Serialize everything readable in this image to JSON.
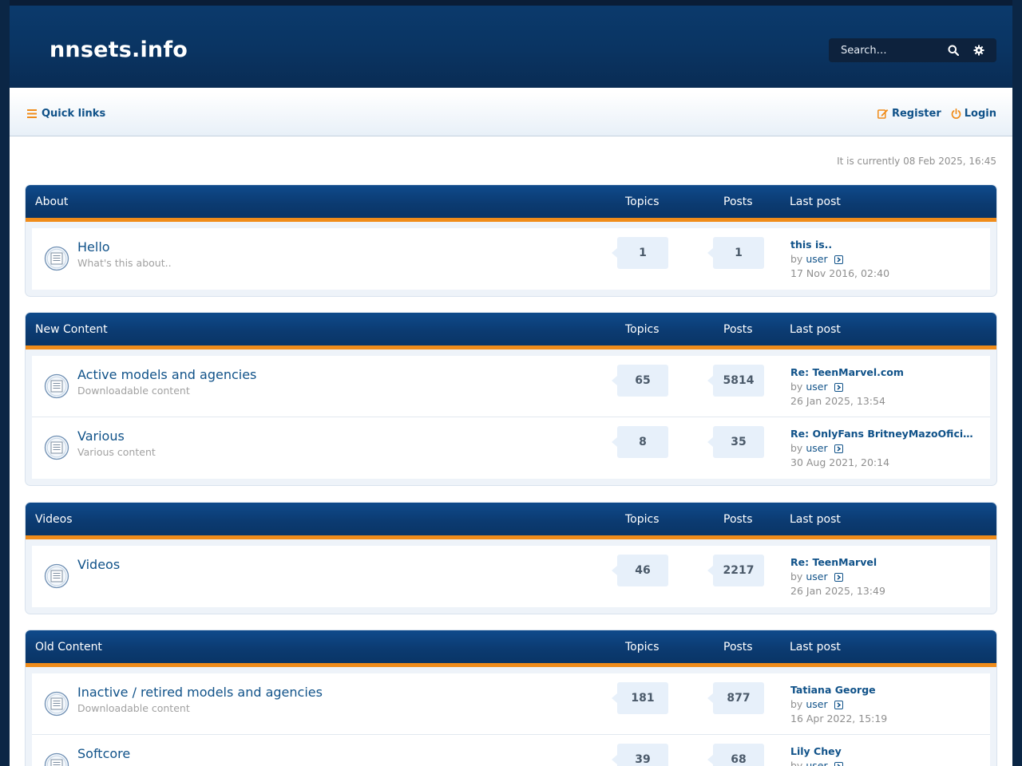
{
  "site": {
    "title": "nnsets.info"
  },
  "search": {
    "placeholder": "Search…"
  },
  "nav": {
    "quick_links": "Quick links",
    "register": "Register",
    "login": "Login"
  },
  "current_time": "It is currently 08 Feb 2025, 16:45",
  "columns": {
    "topics": "Topics",
    "posts": "Posts",
    "last_post": "Last post"
  },
  "by_label": "by",
  "categories": [
    {
      "name": "About",
      "forums": [
        {
          "title": "Hello",
          "desc": "What's this about..",
          "topics": "1",
          "posts": "1",
          "last_title": "this is..",
          "last_user": "user",
          "last_date": "17 Nov 2016, 02:40"
        }
      ]
    },
    {
      "name": "New Content",
      "forums": [
        {
          "title": "Active models and agencies",
          "desc": "Downloadable content",
          "topics": "65",
          "posts": "5814",
          "last_title": "Re: TeenMarvel.com",
          "last_user": "user",
          "last_date": "26 Jan 2025, 13:54"
        },
        {
          "title": "Various",
          "desc": "Various content",
          "topics": "8",
          "posts": "35",
          "last_title": "Re: OnlyFans BritneyMazoOfici…",
          "last_user": "user",
          "last_date": "30 Aug 2021, 20:14"
        }
      ]
    },
    {
      "name": "Videos",
      "forums": [
        {
          "title": "Videos",
          "desc": "",
          "topics": "46",
          "posts": "2217",
          "last_title": "Re: TeenMarvel",
          "last_user": "user",
          "last_date": "26 Jan 2025, 13:49"
        }
      ]
    },
    {
      "name": "Old Content",
      "forums": [
        {
          "title": "Inactive / retired models and agencies",
          "desc": "Downloadable content",
          "topics": "181",
          "posts": "877",
          "last_title": "Tatiana George",
          "last_user": "user",
          "last_date": "16 Apr 2022, 15:19"
        },
        {
          "title": "Softcore",
          "desc": "",
          "topics": "39",
          "posts": "68",
          "last_title": "Lily Chey",
          "last_user": "user",
          "last_date": ""
        }
      ]
    }
  ],
  "colors": {
    "accent": "#f08c1a",
    "link": "#105289",
    "header": "#0b3a6c"
  }
}
